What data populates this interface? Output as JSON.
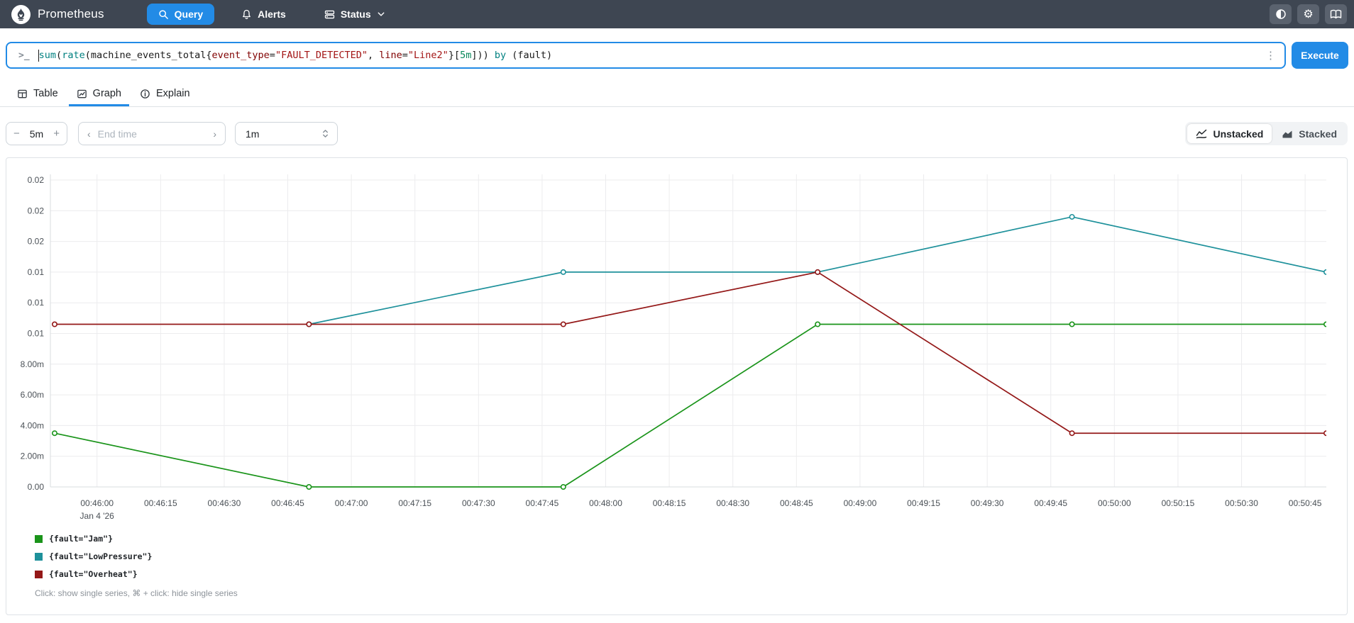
{
  "navbar": {
    "brand": "Prometheus",
    "query_label": "Query",
    "alerts_label": "Alerts",
    "status_label": "Status",
    "colors": {
      "bg": "#3e4652",
      "active_blue": "#228be6",
      "icon_button_bg": "#5a626e"
    }
  },
  "query_bar": {
    "tokens": [
      {
        "text": "sum",
        "color": "#008080"
      },
      {
        "text": "(",
        "color": "#1a1a1a"
      },
      {
        "text": "rate",
        "color": "#008080"
      },
      {
        "text": "(machine_events_total{",
        "color": "#1a1a1a"
      },
      {
        "text": "event_type",
        "color": "#800000"
      },
      {
        "text": "=",
        "color": "#1a1a1a"
      },
      {
        "text": "\"FAULT_DETECTED\"",
        "color": "#a31515"
      },
      {
        "text": ", ",
        "color": "#1a1a1a"
      },
      {
        "text": "line",
        "color": "#800000"
      },
      {
        "text": "=",
        "color": "#1a1a1a"
      },
      {
        "text": "\"Line2\"",
        "color": "#a31515"
      },
      {
        "text": "}[",
        "color": "#1a1a1a"
      },
      {
        "text": "5m",
        "color": "#09885a"
      },
      {
        "text": "])) ",
        "color": "#1a1a1a"
      },
      {
        "text": "by",
        "color": "#008080"
      },
      {
        "text": " (fault)",
        "color": "#1a1a1a"
      }
    ],
    "execute_label": "Execute"
  },
  "tabs": {
    "table": "Table",
    "graph": "Graph",
    "explain": "Explain"
  },
  "controls": {
    "decrease": "−",
    "range_value": "5m",
    "increase": "+",
    "end_prev": "‹",
    "end_time_placeholder": "End time",
    "end_next": "›",
    "resolution_value": "1m",
    "unstacked": "Unstacked",
    "stacked": "Stacked"
  },
  "chart_data": {
    "type": "line",
    "title": "",
    "x_domain": [
      "00:45:49",
      "00:50:50"
    ],
    "x_date_label": "Jan 4 '26",
    "x_ticks": [
      "00:46:00",
      "00:46:15",
      "00:46:30",
      "00:46:45",
      "00:47:00",
      "00:47:15",
      "00:47:30",
      "00:47:45",
      "00:48:00",
      "00:48:15",
      "00:48:30",
      "00:48:45",
      "00:49:00",
      "00:49:15",
      "00:49:30",
      "00:49:45",
      "00:50:00",
      "00:50:15",
      "00:50:30",
      "00:50:45"
    ],
    "ylim": [
      0,
      0.02
    ],
    "y_ticks": [
      {
        "value": 0.02,
        "label": "0.02"
      },
      {
        "value": 0.018,
        "label": "0.02"
      },
      {
        "value": 0.016,
        "label": "0.02"
      },
      {
        "value": 0.014,
        "label": "0.01"
      },
      {
        "value": 0.012,
        "label": "0.01"
      },
      {
        "value": 0.01,
        "label": "0.01"
      },
      {
        "value": 0.008,
        "label": "8.00m"
      },
      {
        "value": 0.006,
        "label": "6.00m"
      },
      {
        "value": 0.004,
        "label": "4.00m"
      },
      {
        "value": 0.002,
        "label": "2.00m"
      },
      {
        "value": 0.0,
        "label": "0.00"
      }
    ],
    "grid": true,
    "legend_position": "bottom-left",
    "sample_times": [
      "00:45:50",
      "00:46:50",
      "00:47:50",
      "00:48:50",
      "00:49:50",
      "00:50:50"
    ],
    "series": [
      {
        "name": "{fault=\"Jam\"}",
        "color": "#1a941a",
        "values": [
          0.0035,
          0,
          0,
          0.0106,
          0.0106,
          0.0106
        ]
      },
      {
        "name": "{fault=\"LowPressure\"}",
        "color": "#1e919b",
        "values": [
          null,
          0.0106,
          0.014,
          0.014,
          0.0176,
          0.014
        ]
      },
      {
        "name": "{fault=\"Overheat\"}",
        "color": "#941818",
        "values": [
          0.0106,
          0.0106,
          0.0106,
          0.014,
          0.0035,
          0.0035
        ]
      }
    ]
  },
  "legend_note": "Click: show single series, ⌘ + click: hide single series"
}
